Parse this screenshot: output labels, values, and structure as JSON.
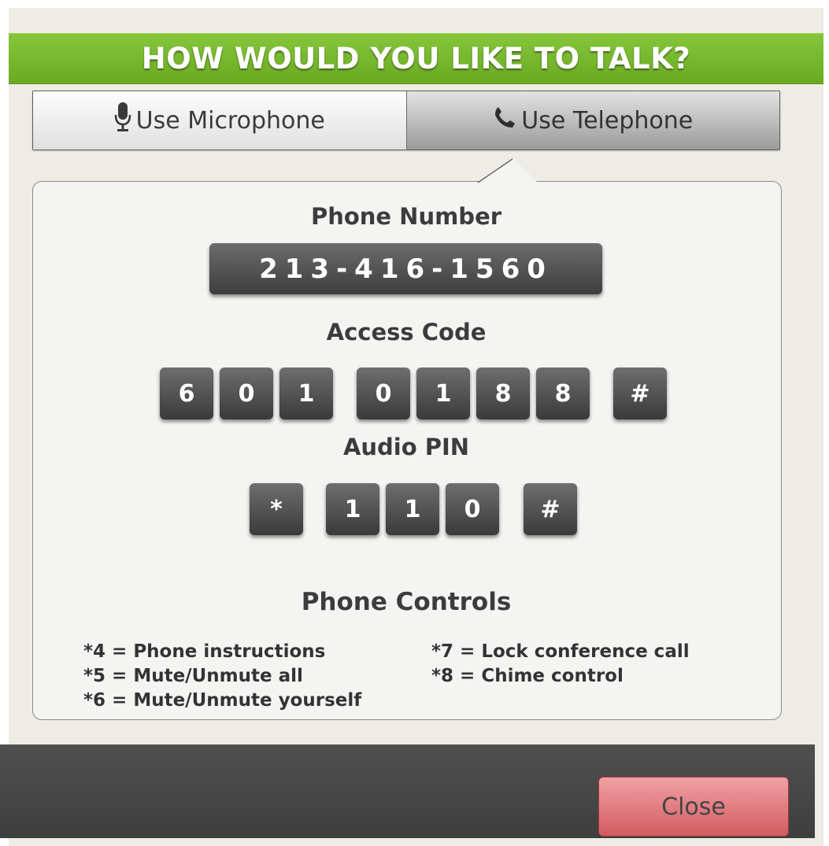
{
  "dialog": {
    "title": "HOW WOULD YOU LIKE TO TALK?",
    "accent_color": "#7dbb32"
  },
  "tabs": [
    {
      "label": "Use Microphone",
      "icon": "microphone-icon",
      "selected": false
    },
    {
      "label": "Use Telephone",
      "icon": "telephone-icon",
      "selected": true
    }
  ],
  "phone": {
    "label": "Phone Number",
    "number": "213-416-1560"
  },
  "access_code": {
    "label": "Access Code",
    "keys": [
      "6",
      "0",
      "1",
      "0",
      "1",
      "8",
      "8",
      "#"
    ]
  },
  "audio_pin": {
    "label": "Audio PIN",
    "keys": [
      "*",
      "1",
      "1",
      "0",
      "#"
    ]
  },
  "controls": {
    "label": "Phone Controls",
    "items": [
      "*4 = Phone instructions",
      "*5 = Mute/Unmute all",
      "*6 = Mute/Unmute yourself",
      "*7 = Lock conference call",
      "*8 = Chime control"
    ]
  },
  "footer": {
    "close_label": "Close",
    "close_color": "#e07a80"
  }
}
